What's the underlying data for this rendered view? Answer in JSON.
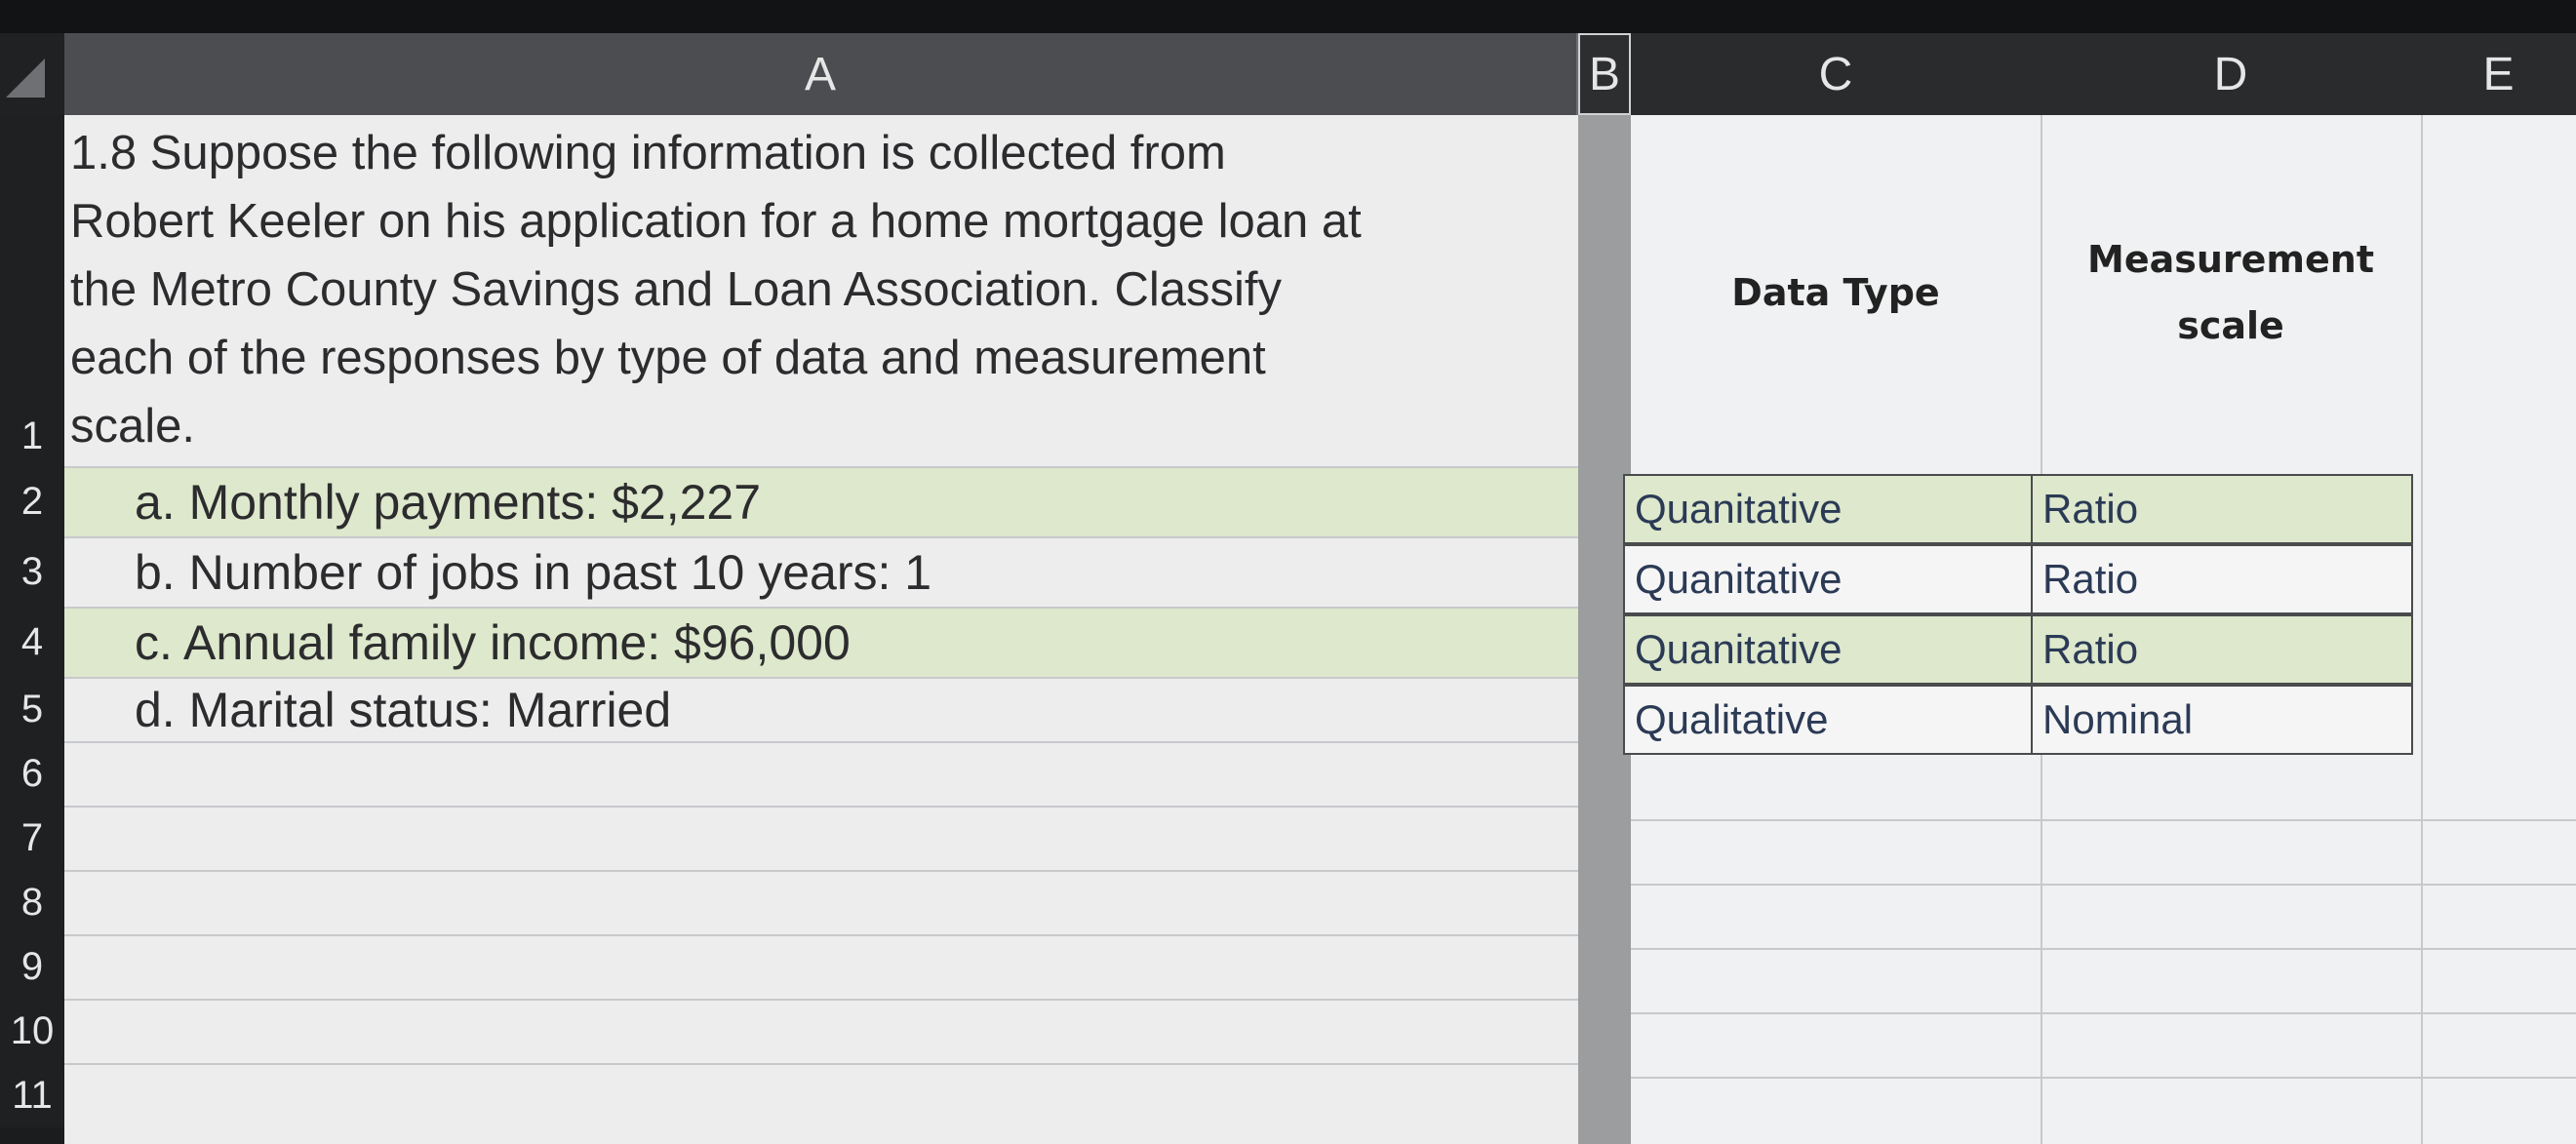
{
  "columns": [
    "A",
    "B",
    "C",
    "D",
    "E"
  ],
  "rows": [
    "1",
    "2",
    "3",
    "4",
    "5",
    "6",
    "7",
    "8",
    "9",
    "10",
    "11"
  ],
  "a1_lines": [
    "1.8 Suppose the following information is collected from",
    "Robert Keeler on his application for a home mortgage loan at",
    "the Metro County Savings and Loan Association. Classify",
    "each of the responses by type of data and measurement",
    "scale."
  ],
  "items": [
    "a. Monthly payments: $2,227",
    "b. Number of jobs in past 10 years: 1",
    "c. Annual family income: $96,000",
    "d. Marital status: Married"
  ],
  "headers": {
    "c1": "Data Type",
    "d1_line1": "Measurement",
    "d1_line2": "scale"
  },
  "answers": [
    {
      "data_type": "Quanitative",
      "scale": "Ratio"
    },
    {
      "data_type": "Quanitative",
      "scale": "Ratio"
    },
    {
      "data_type": "Quanitative",
      "scale": "Ratio"
    },
    {
      "data_type": "Qualitative",
      "scale": "Nominal"
    }
  ],
  "colors": {
    "band": "#dde8cc",
    "header_bg": "#2a2b2d",
    "selected_col_header": "#4b4d50"
  }
}
